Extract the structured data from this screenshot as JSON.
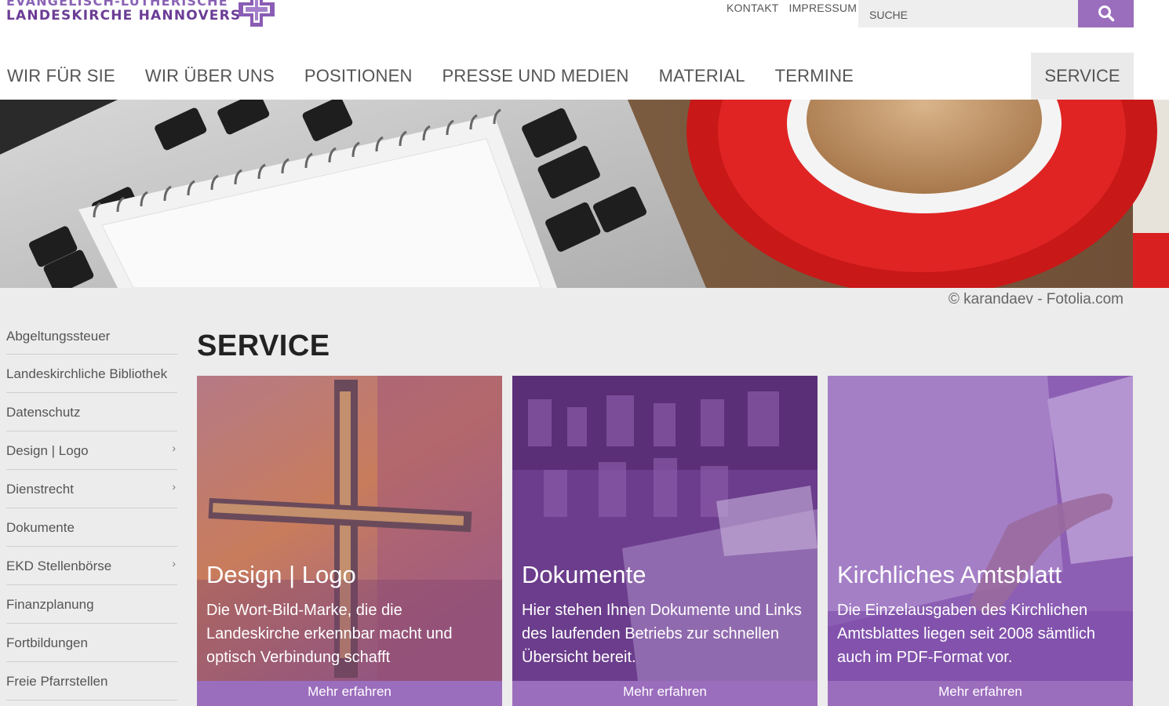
{
  "header": {
    "logo_line1": "EVANGELISCH-LUTHERISCHE",
    "logo_line2": "LANDESKIRCHE HANNOVERS",
    "top_links": [
      "KONTAKT",
      "IMPRESSUM"
    ],
    "search_placeholder": "SUCHE",
    "search_icon": "search-icon",
    "brand_color": "#9b6dbd"
  },
  "nav": {
    "items": [
      "WIR FÜR SIE",
      "WIR ÜBER UNS",
      "POSITIONEN",
      "PRESSE UND MEDIEN",
      "MATERIAL",
      "TERMINE"
    ],
    "active": "SERVICE"
  },
  "hero": {
    "credit": "© karandaev - Fotolia.com"
  },
  "sidebar": {
    "items": [
      {
        "label": "Abgeltungssteuer",
        "has_children": false
      },
      {
        "label": "Landeskirchliche Bibliothek",
        "has_children": false
      },
      {
        "label": "Datenschutz",
        "has_children": false
      },
      {
        "label": "Design | Logo",
        "has_children": true
      },
      {
        "label": "Dienstrecht",
        "has_children": true
      },
      {
        "label": "Dokumente",
        "has_children": false
      },
      {
        "label": "EKD Stellenbörse",
        "has_children": true
      },
      {
        "label": "Finanzplanung",
        "has_children": false
      },
      {
        "label": "Fortbildungen",
        "has_children": false
      },
      {
        "label": "Freie Pfarrstellen",
        "has_children": false
      }
    ]
  },
  "main": {
    "title": "SERVICE",
    "cards": [
      {
        "title": "Design | Logo",
        "text": "Die Wort-Bild-Marke, die die Landeskirche erkennbar macht und optisch Verbindung schafft",
        "button": "Mehr erfahren"
      },
      {
        "title": "Dokumente",
        "text": "Hier stehen Ihnen Dokumente und Links des laufenden Betriebs zur schnellen Übersicht bereit.",
        "button": "Mehr erfahren"
      },
      {
        "title": "Kirchliches Amtsblatt",
        "text": "Die Einzelausgaben des Kirchlichen Amtsblattes liegen seit 2008 sämtlich auch im PDF-Format vor.",
        "button": "Mehr erfahren"
      }
    ]
  }
}
